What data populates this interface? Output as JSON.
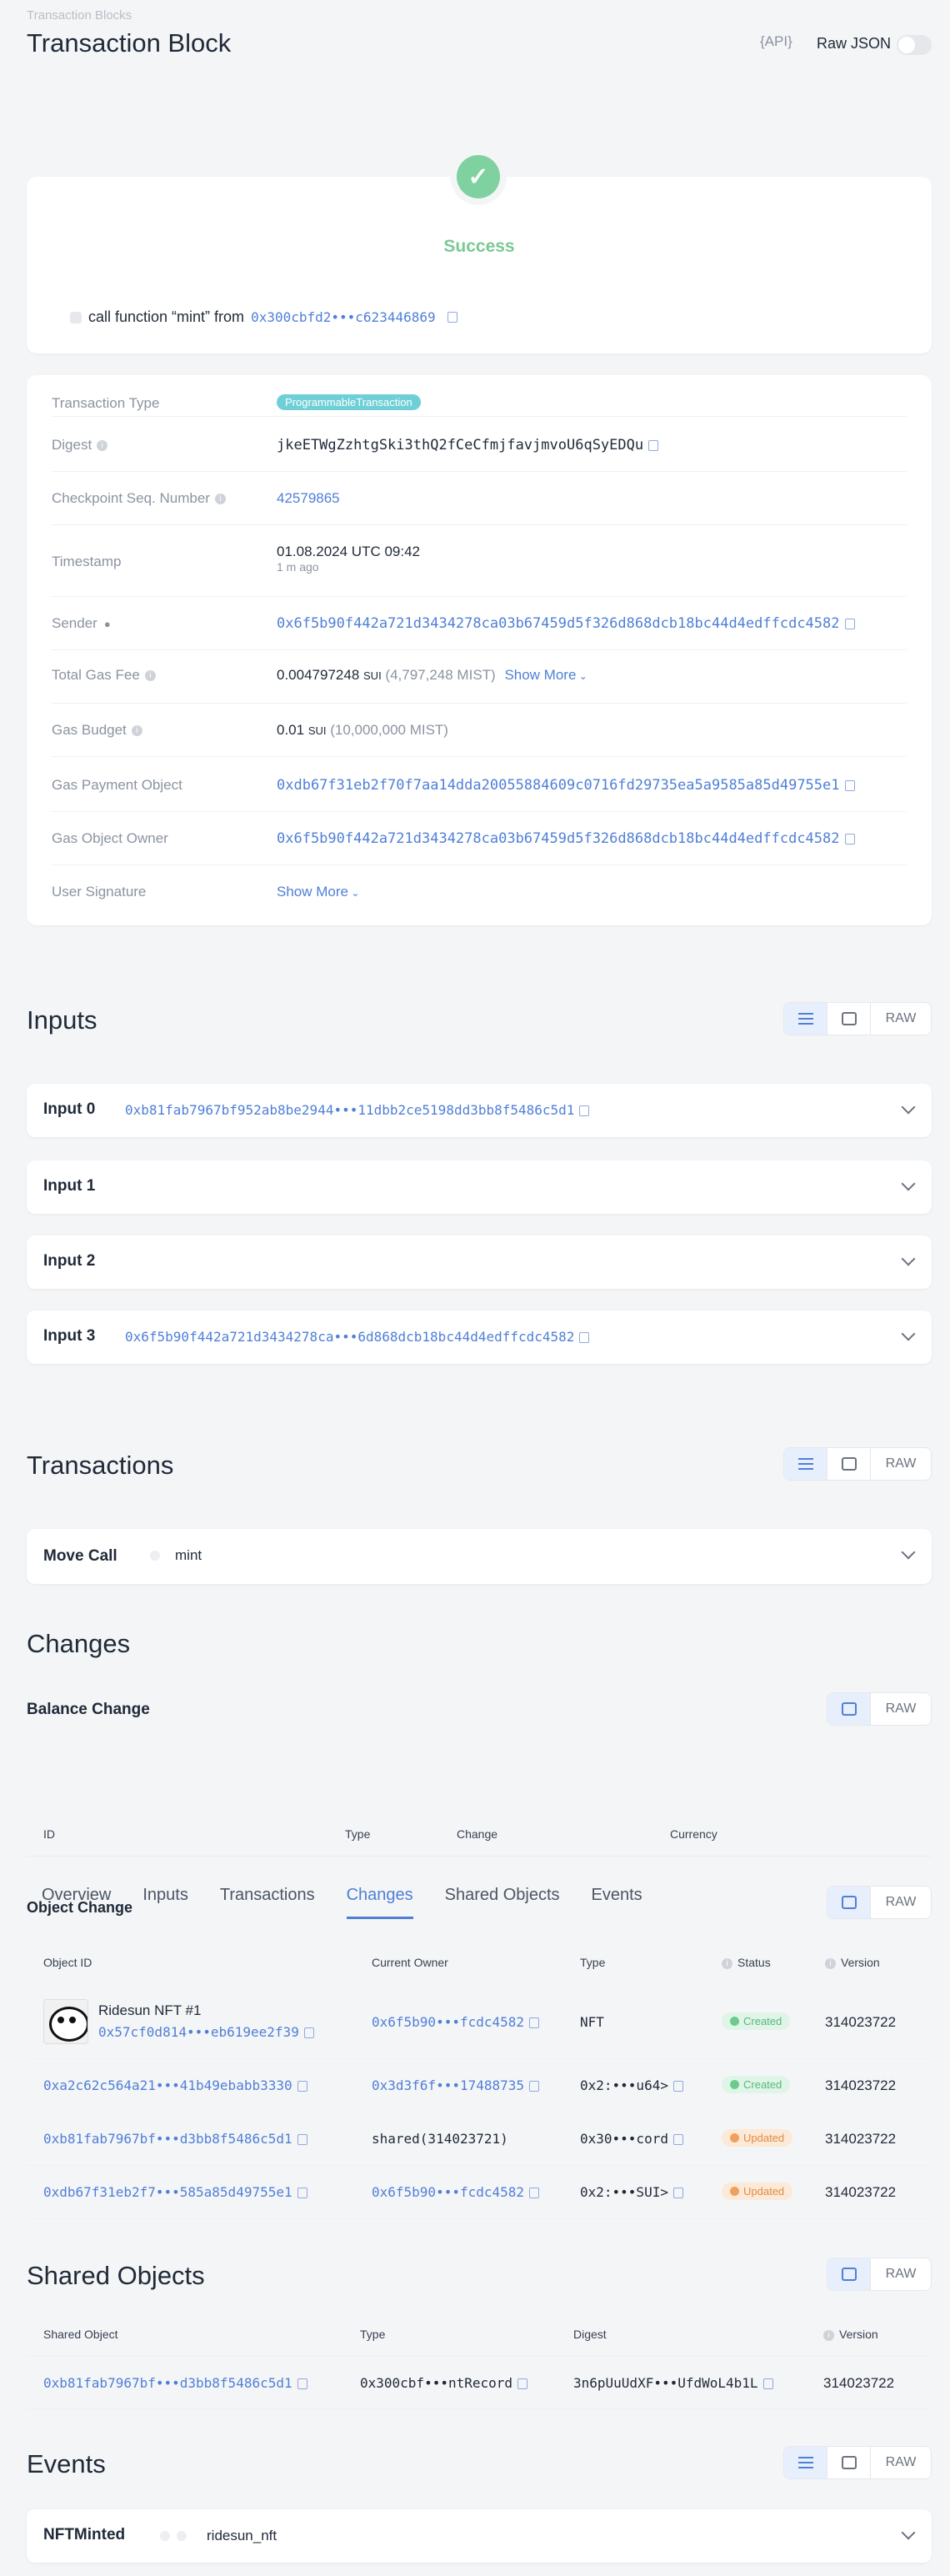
{
  "header": {
    "breadcrumb": "Transaction Blocks",
    "title": "Transaction Block",
    "api": "{API}",
    "raw_json": "Raw JSON"
  },
  "status": {
    "label": "Success",
    "summary_prefix": "call function “mint” from",
    "summary_address": "0x300cbfd2•••c623446869"
  },
  "details": {
    "tx_type_label": "Transaction Type",
    "tx_type": "ProgrammableTransaction",
    "digest_label": "Digest",
    "digest": "jkeETWgZzhtgSki3thQ2fCeCfmjfavjmvoU6qSyEDQu",
    "checkpoint_label": "Checkpoint Seq. Number",
    "checkpoint": "42579865",
    "timestamp_label": "Timestamp",
    "timestamp": "01.08.2024 UTC 09:42",
    "timestamp_ago": "1 m ago",
    "sender_label": "Sender",
    "sender": "0x6f5b90f442a721d3434278ca03b67459d5f326d868dcb18bc44d4edffcdc4582",
    "gas_fee_label": "Total Gas Fee",
    "gas_fee": "0.004797248",
    "gas_fee_unit": "SUI",
    "gas_fee_mist": "(4,797,248 MIST)",
    "show_more": "Show More",
    "gas_budget_label": "Gas Budget",
    "gas_budget": "0.01",
    "gas_budget_unit": "SUI",
    "gas_budget_mist": "(10,000,000 MIST)",
    "gas_payment_label": "Gas Payment Object",
    "gas_payment": "0xdb67f31eb2f70f7aa14dda20055884609c0716fd29735ea5a9585a85d49755e1",
    "gas_owner_label": "Gas Object Owner",
    "gas_owner": "0x6f5b90f442a721d3434278ca03b67459d5f326d868dcb18bc44d4edffcdc4582",
    "signature_label": "User Signature",
    "signature_show_more": "Show More"
  },
  "raw_label": "RAW",
  "inputs": {
    "title": "Inputs",
    "items": [
      {
        "label": "Input 0",
        "value": "0xb81fab7967bf952ab8be2944•••11dbb2ce5198dd3bb8f5486c5d1"
      },
      {
        "label": "Input 1",
        "value": ""
      },
      {
        "label": "Input 2",
        "value": ""
      },
      {
        "label": "Input 3",
        "value": "0x6f5b90f442a721d3434278ca•••6d868dcb18bc44d4edffcdc4582"
      }
    ]
  },
  "transactions": {
    "title": "Transactions",
    "move_call": "Move Call",
    "fn": "mint"
  },
  "changes": {
    "title": "Changes",
    "balance_change": "Balance Change",
    "balance_headers": [
      "ID",
      "Type",
      "Change",
      "Currency"
    ],
    "object_change": "Object Change",
    "tabs": [
      "Overview",
      "Inputs",
      "Transactions",
      "Changes",
      "Shared Objects",
      "Events"
    ],
    "object_headers": [
      "Object ID",
      "Current Owner",
      "Type",
      "Status",
      "Version"
    ],
    "rows": [
      {
        "name": "Ridesun NFT #1",
        "id": "0x57cf0d814•••eb619ee2f39",
        "owner": "0x6f5b90•••fcdc4582",
        "type": "NFT",
        "status": "Created",
        "version": "314023722"
      },
      {
        "name": "",
        "id": "0xa2c62c564a21•••41b49ebabb3330",
        "owner": "0x3d3f6f•••17488735",
        "type": "0x2:•••u64>",
        "status": "Created",
        "version": "314023722"
      },
      {
        "name": "",
        "id": "0xb81fab7967bf•••d3bb8f5486c5d1",
        "owner": "shared(314023721)",
        "type": "0x30•••cord",
        "status": "Updated",
        "version": "314023722"
      },
      {
        "name": "",
        "id": "0xdb67f31eb2f7•••585a85d49755e1",
        "owner": "0x6f5b90•••fcdc4582",
        "type": "0x2:•••SUI>",
        "status": "Updated",
        "version": "314023722"
      }
    ]
  },
  "shared": {
    "title": "Shared Objects",
    "headers": [
      "Shared Object",
      "Type",
      "Digest",
      "Version"
    ],
    "row": {
      "object": "0xb81fab7967bf•••d3bb8f5486c5d1",
      "type": "0x300cbf•••ntRecord",
      "digest": "3n6pUuUdXF•••UfdWoL4b1L",
      "version": "314023722"
    }
  },
  "events": {
    "title": "Events",
    "name": "NFTMinted",
    "module": "ridesun_nft"
  }
}
